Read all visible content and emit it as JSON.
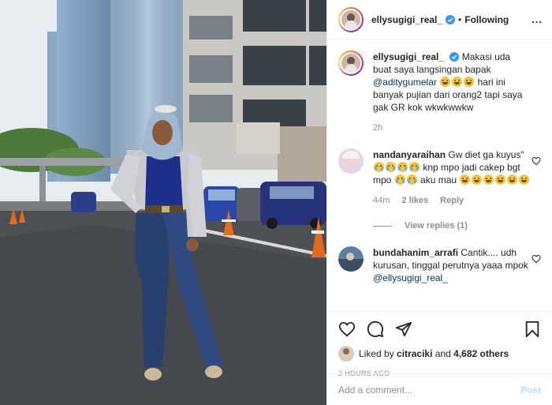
{
  "header": {
    "username": "ellysugigi_real_",
    "separator": "•",
    "follow_label": "Following",
    "more_label": "..."
  },
  "caption": {
    "username": "ellysugigi_real_",
    "text_part1": "Makasi uda buat saya langsingan bapak",
    "mention": "@aditygumelar",
    "text_part2": "hari ini banyak pujian dari orang2 tapi saya gak GR kok wkwkwwkw",
    "time": "2h"
  },
  "comments": [
    {
      "username": "nandanyaraihan",
      "text_part1": "Gw diet ga kuyus\"",
      "text_part2": "knp mpo jadi cakep bgt mpo",
      "text_part3": "aku mau",
      "time": "44m",
      "likes": "2 likes",
      "reply": "Reply",
      "view_replies": "View replies (1)"
    },
    {
      "username": "bundahanim_arrafi",
      "text": "Cantik.... udh kurusan, tinggal perutnya yaaa mpok",
      "mention": "@ellysugigi_real_"
    }
  ],
  "likes": {
    "prefix": "Liked by",
    "user": "citraciki",
    "connector": "and",
    "others": "4,682 others"
  },
  "timestamp": "2 HOURS AGO",
  "add_comment": {
    "placeholder": "Add a comment...",
    "post_label": "Post"
  },
  "colors": {
    "link": "#00376b",
    "verified": "#3897f0",
    "muted": "#8e8e8e",
    "post_disabled": "#b2dffc"
  }
}
